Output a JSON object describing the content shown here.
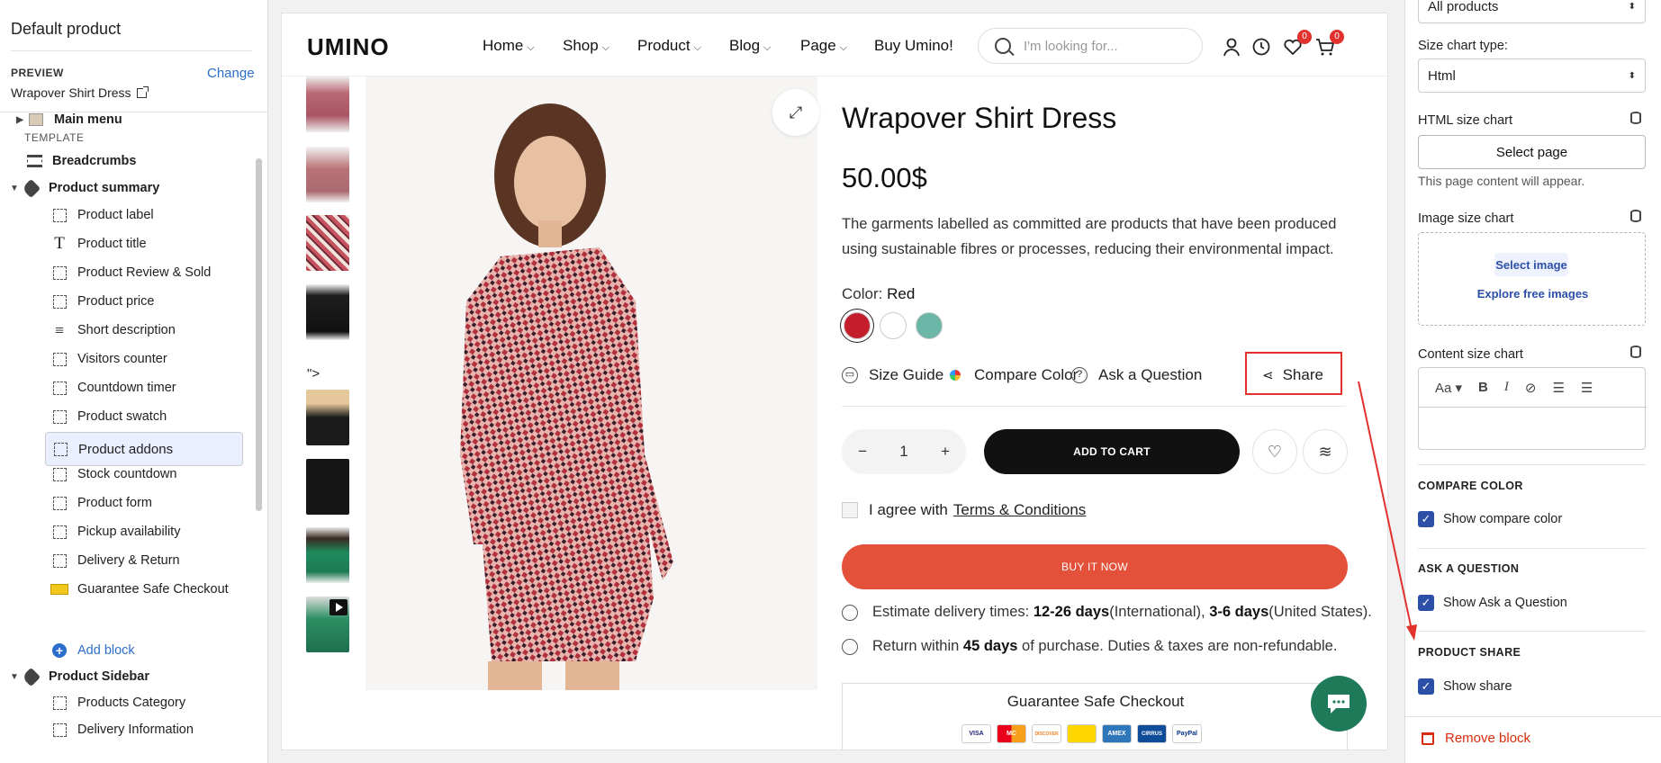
{
  "left": {
    "header": "Default product",
    "preview_label": "PREVIEW",
    "preview_change": "Change",
    "preview_value": "Wrapover Shirt Dress",
    "main_menu": "Main menu",
    "template_label": "TEMPLATE",
    "breadcrumbs": "Breadcrumbs",
    "product_summary": "Product summary",
    "blocks": [
      "Product label",
      "Product title",
      "Product Review & Sold",
      "Product price",
      "Short description",
      "Visitors counter",
      "Countdown timer",
      "Product swatch",
      "Product addons",
      "Stock countdown",
      "Product form",
      "Pickup availability",
      "Delivery & Return",
      "Guarantee Safe Checkout"
    ],
    "add_block": "Add block",
    "product_sidebar": "Product Sidebar",
    "sidebar_blocks": [
      "Products Category",
      "Delivery Information"
    ]
  },
  "store": {
    "logo": "UMINO",
    "nav": [
      "Home",
      "Shop",
      "Product",
      "Blog",
      "Page",
      "Buy Umino!"
    ],
    "search_placeholder": "I'm looking for...",
    "wishlist_count": "0",
    "cart_count": "0",
    "gallery_quote": "\">",
    "title": "Wrapover Shirt Dress",
    "price": "50.00$",
    "description": "The garments labelled as committed are products that have been produced using sustainable fibres or processes, reducing their environmental impact.",
    "color_label": "Color:",
    "color_value": "Red",
    "swatches": [
      "#c41d2b",
      "#ffffff",
      "#6bb6a6"
    ],
    "size_guide": "Size Guide",
    "compare_color": "Compare Color",
    "ask_question": "Ask a Question",
    "share": "Share",
    "qty": "1",
    "add_to_cart": "ADD TO CART",
    "agree_text": "I agree with",
    "terms": "Terms & Conditions",
    "buy_now": "BUY IT NOW",
    "delivery": {
      "pre": "Estimate delivery times: ",
      "d1": "12-26 days",
      "m1": " (International), ",
      "d2": "3-6 days",
      "post": " (United States)."
    },
    "return": {
      "pre": "Return within ",
      "d": "45 days",
      "post": " of purchase. Duties & taxes are non-refundable."
    },
    "guarantee_title": "Guarantee Safe Checkout",
    "cards": [
      "VISA",
      "MC",
      "DISCOVER",
      "",
      "AMEX",
      "CIRRUS",
      "PayPal"
    ]
  },
  "right": {
    "products_select": "All products",
    "size_chart_type_label": "Size chart type:",
    "size_chart_type": "Html",
    "html_size_chart": "HTML size chart",
    "select_page": "Select page",
    "page_hint": "This page content will appear.",
    "image_size_chart": "Image size chart",
    "select_image": "Select image",
    "explore": "Explore free images",
    "content_size_chart": "Content size chart",
    "compare_color_head": "COMPARE COLOR",
    "show_compare_color": "Show compare color",
    "ask_head": "ASK A QUESTION",
    "show_ask": "Show Ask a Question",
    "share_head": "PRODUCT SHARE",
    "show_share": "Show share",
    "remove_block": "Remove block"
  }
}
